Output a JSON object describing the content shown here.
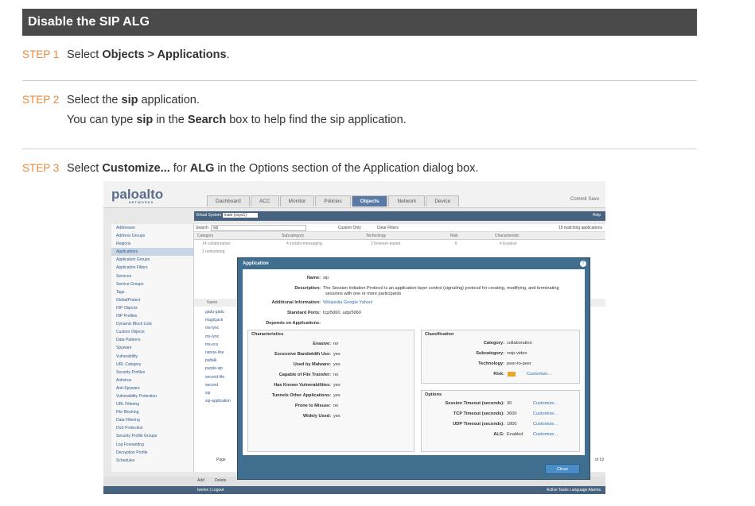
{
  "header": {
    "title": "Disable the SIP ALG"
  },
  "steps": [
    {
      "num": "STEP 1",
      "pre": "Select ",
      "bold": "Objects > Applications",
      "post": "."
    },
    {
      "num": "STEP 2",
      "pre": "Select the ",
      "bold": "sip",
      "post": " application.",
      "sub_pre": "You can type ",
      "sub_b1": "sip",
      "sub_mid": " in the ",
      "sub_b2": "Search",
      "sub_post": " box to help find the sip application."
    },
    {
      "num": "STEP 3",
      "pre": "Select ",
      "bold": "Customize...",
      "mid": " for ",
      "bold2": "ALG",
      "post": " in the Options section of the Application dialog box."
    }
  ],
  "screenshot": {
    "logo": "paloalto",
    "logo_sub": "NETWORKS",
    "tabs": [
      "Dashboard",
      "ACC",
      "Monitor",
      "Policies",
      "Objects",
      "Network",
      "Device"
    ],
    "active_tab": "Objects",
    "top_right": "Commit   Save",
    "vsys_label": "Virtual System",
    "vsys_value": "main (vsys1)",
    "search_label": "Search",
    "search_value": "sip",
    "custom_only": "Custom Only",
    "clear_filters": "Clear Filters",
    "matching": "15 matching applications",
    "help": "Help",
    "columns": [
      "Category",
      "Subcategory",
      "Technology",
      "Risk",
      "Characteristic"
    ],
    "filter_row": [
      "14 collaboration",
      "4 instant-messaging",
      "2 browser-based",
      "6",
      "4 Evasive"
    ],
    "filter_row2": "1 networking",
    "name_header": "Name",
    "sidebar": [
      "Addresses",
      "Address Groups",
      "Regions",
      "Applications",
      "Application Groups",
      "Application Filters",
      "Services",
      "Service Groups",
      "Tags",
      "GlobalProtect",
      "HIP Objects",
      "HIP Profiles",
      "Dynamic Block Lists",
      "Custom Objects",
      "Data Patterns",
      "Spyware",
      "Vulnerability",
      "URL Category",
      "Security Profiles",
      "Antivirus",
      "Anti-Spyware",
      "Vulnerability Protection",
      "URL Filtering",
      "File Blocking",
      "Data Filtering",
      "DoS Protection",
      "Security Profile Groups",
      "Log Forwarding",
      "Decryption Profile",
      "Schedules"
    ],
    "list": [
      "gadu-gadu",
      "magicjack",
      "ms-lync",
      "ms-lync",
      "ms-ocs",
      "nanoe-line",
      "paltalk",
      "purple-sip",
      "second-life",
      "second",
      "sip",
      "sip-application"
    ],
    "page_label": "Page",
    "of_label": "of 19",
    "add": "Add",
    "delete": "Delete",
    "status_left": "twelve | Logout",
    "status_right": "Active   Tasks  Language  Alarms",
    "dialog": {
      "title": "Application",
      "name_k": "Name:",
      "name_v": "sip",
      "desc_k": "Description:",
      "desc_v1": "The Session Initiation Protocol is an application-layer control (signaling) protocol for creating, modifying, and terminating",
      "desc_v2": "sessions with one or more participants",
      "info_k": "Additional Information:",
      "info_v": "Wikipedia  Google  Yahoo!",
      "ports_k": "Standard Ports:",
      "ports_v": "tcp/5060, udp/5060",
      "depends_k": "Depends on Applications:",
      "char_title": "Characteristics",
      "chars": [
        {
          "k": "Evasive:",
          "v": "no"
        },
        {
          "k": "Excessive Bandwidth Use:",
          "v": "yes"
        },
        {
          "k": "Used by Malware:",
          "v": "yes"
        },
        {
          "k": "Capable of File Transfer:",
          "v": "no"
        },
        {
          "k": "Has Known Vulnerabilities:",
          "v": "yes"
        },
        {
          "k": "Tunnels Other Applications:",
          "v": "yes"
        },
        {
          "k": "Prone to Misuse:",
          "v": "no"
        },
        {
          "k": "Widely Used:",
          "v": "yes"
        }
      ],
      "class_title": "Classification",
      "class": [
        {
          "k": "Category:",
          "v": "collaboration"
        },
        {
          "k": "Subcategory:",
          "v": "voip-video"
        },
        {
          "k": "Technology:",
          "v": "peer-to-peer"
        },
        {
          "k": "Risk:",
          "v": "Customize..."
        }
      ],
      "opt_title": "Options",
      "opts": [
        {
          "k": "Session Timeout (seconds):",
          "v": "30",
          "l": "Customize..."
        },
        {
          "k": "TCP Timeout (seconds):",
          "v": "3600",
          "l": "Customize..."
        },
        {
          "k": "UDP Timeout (seconds):",
          "v": "1800",
          "l": "Customize..."
        },
        {
          "k": "ALG:",
          "v": "Enabled",
          "l": "Customize..."
        }
      ],
      "close": "Close"
    }
  }
}
